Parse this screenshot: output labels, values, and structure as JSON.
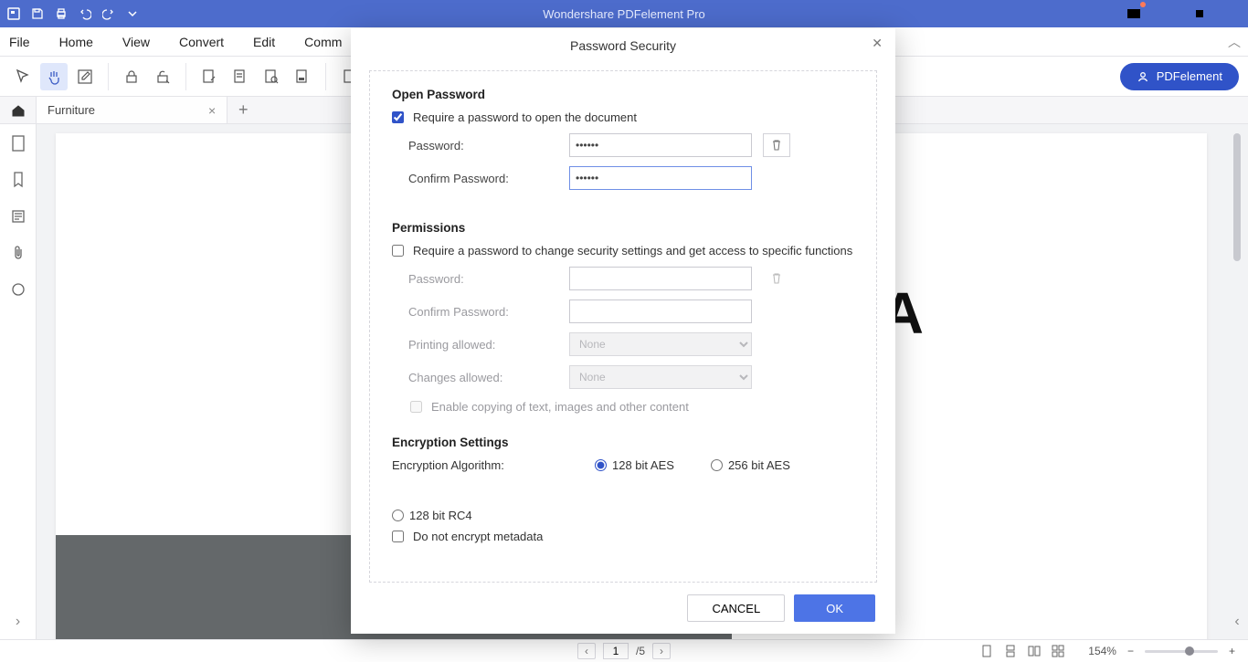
{
  "title": "Wondershare PDFelement Pro",
  "menu": [
    "File",
    "Home",
    "View",
    "Convert",
    "Edit",
    "Comm"
  ],
  "account_button": "PDFelement",
  "tabs": [
    {
      "label": "Furniture"
    }
  ],
  "leftbar_tooltips": [
    "thumbnails",
    "bookmarks",
    "annotations",
    "attachments",
    "comments"
  ],
  "document_glyph": "A",
  "modal": {
    "title": "Password Security",
    "open_password": {
      "heading": "Open Password",
      "require_label": "Require a password to open the document",
      "require_checked": true,
      "password_label": "Password:",
      "password_value": "******",
      "confirm_label": "Confirm Password:",
      "confirm_value": "******"
    },
    "permissions": {
      "heading": "Permissions",
      "require_label": "Require a password to change security settings and get access to specific functions",
      "require_checked": false,
      "password_label": "Password:",
      "confirm_label": "Confirm Password:",
      "printing_label": "Printing allowed:",
      "printing_value": "None",
      "changes_label": "Changes allowed:",
      "changes_value": "None",
      "enable_copy_label": "Enable copying of text, images and other content"
    },
    "encryption": {
      "heading": "Encryption Settings",
      "algorithm_label": "Encryption Algorithm:",
      "options": [
        "128 bit AES",
        "256 bit AES",
        "128 bit RC4"
      ],
      "selected": "128 bit AES",
      "no_metadata_label": "Do not encrypt metadata"
    },
    "cancel": "CANCEL",
    "ok": "OK"
  },
  "status": {
    "current_page": "1",
    "total_pages": "/5",
    "zoom": "154%"
  }
}
